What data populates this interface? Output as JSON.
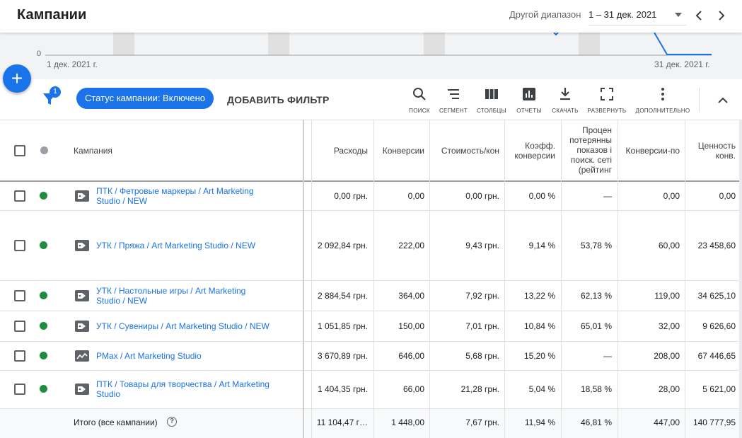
{
  "header": {
    "title": "Кампании",
    "range_label": "Другой диапазон",
    "range_value": "1 – 31 дек. 2021",
    "caret_icon": "caret-down-icon",
    "prev_icon": "chevron-left-icon",
    "next_icon": "chevron-right-icon"
  },
  "chart": {
    "zero_label": "0",
    "start_date": "1 дек. 2021 г.",
    "end_date": "31 дек. 2021 г.",
    "line_color": "#1a73e8"
  },
  "fab": {
    "label": "+",
    "icon": "plus-icon",
    "color": "#1a73e8"
  },
  "toolbar": {
    "filter_badge": "1",
    "status_chip": "Статус кампании: Включено",
    "add_filter": "ДОБАВИТЬ ФИЛЬТР",
    "tools": [
      {
        "icon": "search-icon",
        "label": "ПОИСК"
      },
      {
        "icon": "segment-icon",
        "label": "СЕГМЕНТ"
      },
      {
        "icon": "columns-icon",
        "label": "СТОЛБЦЫ"
      },
      {
        "icon": "reports-icon",
        "label": "ОТЧЕТЫ"
      },
      {
        "icon": "download-icon",
        "label": "СКАЧАТЬ"
      },
      {
        "icon": "expand-icon",
        "label": "РАЗВЕРНУТЬ"
      },
      {
        "icon": "more-vert-icon",
        "label": "ДОПОЛНИТЕЛЬНО"
      }
    ],
    "collapse_icon": "chevron-up-icon"
  },
  "table": {
    "headers": {
      "campaign": "Кампания",
      "cost": "Расходы",
      "conversions": "Конверсии",
      "cost_per_conv": "Стоимость/кон",
      "conv_rate": [
        "Коэфф.",
        "конверсии"
      ],
      "lost_is": [
        "Процен",
        "потерянны",
        "показов і",
        "поиск. сеті",
        "(рейтинг"
      ],
      "conv_by_time": "Конверсии-по",
      "conv_value": [
        "Ценность",
        "конв."
      ]
    },
    "rows": [
      {
        "status_color": "#1e8e3e",
        "icon": "tag-icon",
        "name_lines": [
          "ПТК / Фетровые маркеры / Art Marketing",
          "Studio / NEW"
        ],
        "cost": "0,00 грн.",
        "conversions": "0,00",
        "cost_per_conv": "0,00 грн.",
        "conv_rate": "0,00 %",
        "lost_is": "—",
        "conv_by_time": "0,00",
        "conv_value": "0,00"
      },
      {
        "status_color": "#1e8e3e",
        "icon": "tag-icon",
        "name_lines": [
          "УТК / Пряжа / Art Marketing Studio / NEW"
        ],
        "cost": "2 092,84 грн.",
        "conversions": "222,00",
        "cost_per_conv": "9,43 грн.",
        "conv_rate": "9,14 %",
        "lost_is": "53,78 %",
        "conv_by_time": "60,00",
        "conv_value": "23 458,60"
      },
      {
        "status_color": "#1e8e3e",
        "icon": "tag-icon",
        "name_lines": [
          "УТК / Настольные игры / Art Marketing",
          "Studio / NEW"
        ],
        "cost": "2 884,54 грн.",
        "conversions": "364,00",
        "cost_per_conv": "7,92 грн.",
        "conv_rate": "13,22 %",
        "lost_is": "62,13 %",
        "conv_by_time": "119,00",
        "conv_value": "34 625,10"
      },
      {
        "status_color": "#1e8e3e",
        "icon": "tag-icon",
        "name_lines": [
          "УТК / Сувениры / Art Marketing Studio / NEW"
        ],
        "cost": "1 051,85 грн.",
        "conversions": "150,00",
        "cost_per_conv": "7,01 грн.",
        "conv_rate": "10,84 %",
        "lost_is": "65,01 %",
        "conv_by_time": "32,00",
        "conv_value": "9 626,60"
      },
      {
        "status_color": "#1e8e3e",
        "icon": "performance-max-icon",
        "name_lines": [
          "PMax / Art Marketing Studio"
        ],
        "cost": "3 670,89 грн.",
        "conversions": "646,00",
        "cost_per_conv": "5,68 грн.",
        "conv_rate": "15,20 %",
        "lost_is": "—",
        "conv_by_time": "208,00",
        "conv_value": "67 446,65"
      },
      {
        "status_color": "#1e8e3e",
        "icon": "tag-icon",
        "name_lines": [
          "ПТК / Товары для творчества / Art Marketing",
          "Studio"
        ],
        "cost": "1 404,35 грн.",
        "conversions": "66,00",
        "cost_per_conv": "21,28 грн.",
        "conv_rate": "5,04 %",
        "lost_is": "18,58 %",
        "conv_by_time": "28,00",
        "conv_value": "5 621,00"
      }
    ],
    "total": {
      "label": "Итого (все кампании)",
      "help_icon": "help-icon",
      "cost": "11 104,47 г…",
      "conversions": "1 448,00",
      "cost_per_conv": "7,67 грн.",
      "conv_rate": "11,94 %",
      "lost_is": "46,81 %",
      "conv_by_time": "447,00",
      "conv_value": "140 777,95"
    }
  }
}
